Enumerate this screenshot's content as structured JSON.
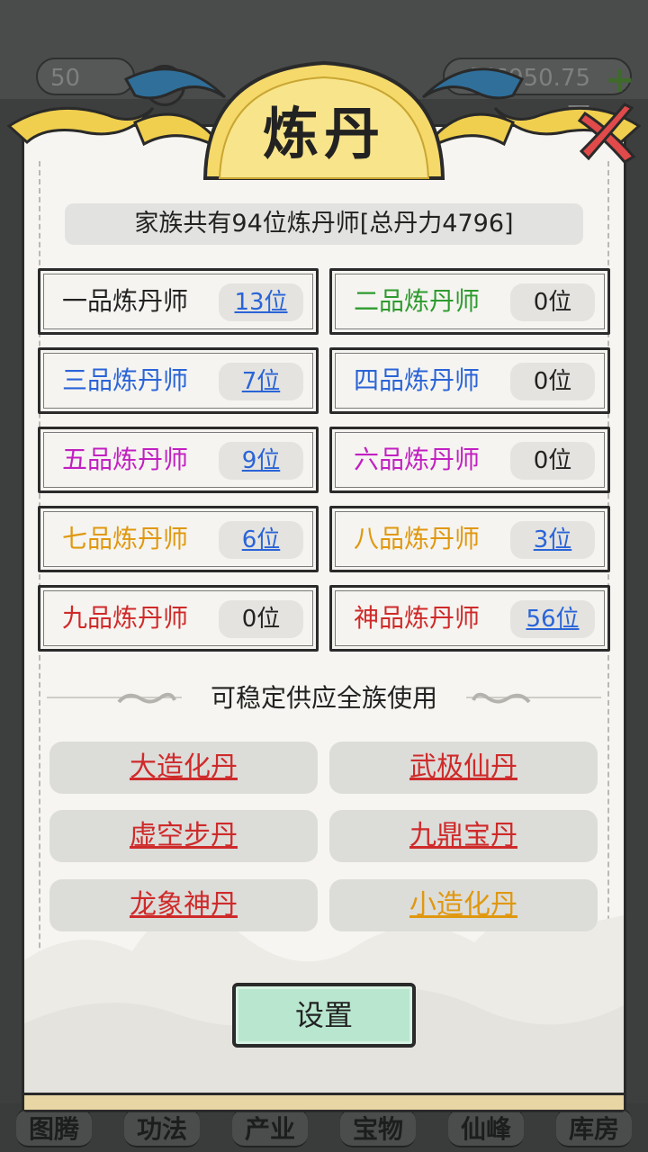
{
  "background": {
    "level_text": "50",
    "help_symbol": "?",
    "money_text": "石6950.75万",
    "plus_symbol": "+",
    "bottom_nav": [
      "图腾",
      "功法",
      "产业",
      "宝物",
      "仙峰",
      "库房"
    ]
  },
  "dialog": {
    "title": "炼丹",
    "summary": "家族共有94位炼丹师[总丹力4796]",
    "ranks": [
      {
        "label": "一品炼丹师",
        "count": "13位",
        "color": "#222222",
        "linked": true
      },
      {
        "label": "二品炼丹师",
        "count": "0位",
        "color": "#2e9b2e",
        "linked": false
      },
      {
        "label": "三品炼丹师",
        "count": "7位",
        "color": "#2a64d8",
        "linked": true
      },
      {
        "label": "四品炼丹师",
        "count": "0位",
        "color": "#2a64d8",
        "linked": false
      },
      {
        "label": "五品炼丹师",
        "count": "9位",
        "color": "#c21fc2",
        "linked": true
      },
      {
        "label": "六品炼丹师",
        "count": "0位",
        "color": "#c21fc2",
        "linked": false
      },
      {
        "label": "七品炼丹师",
        "count": "6位",
        "color": "#e0980f",
        "linked": true
      },
      {
        "label": "八品炼丹师",
        "count": "3位",
        "color": "#e0980f",
        "linked": true
      },
      {
        "label": "九品炼丹师",
        "count": "0位",
        "color": "#cf2a2a",
        "linked": false
      },
      {
        "label": "神品炼丹师",
        "count": "56位",
        "color": "#cf2a2a",
        "linked": true
      }
    ],
    "section_title": "可稳定供应全族使用",
    "pills": [
      {
        "label": "大造化丹",
        "color": "#cf2a2a"
      },
      {
        "label": "武极仙丹",
        "color": "#cf2a2a"
      },
      {
        "label": "虚空步丹",
        "color": "#cf2a2a"
      },
      {
        "label": "九鼎宝丹",
        "color": "#cf2a2a"
      },
      {
        "label": "龙象神丹",
        "color": "#cf2a2a"
      },
      {
        "label": "小造化丹",
        "color": "#e0980f"
      }
    ],
    "settings_label": "设置"
  }
}
